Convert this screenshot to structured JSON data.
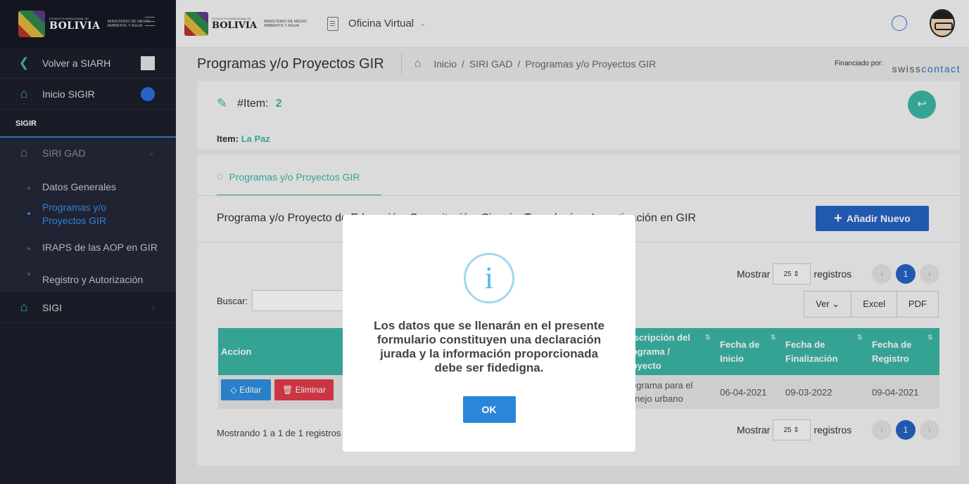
{
  "sidebar": {
    "logo": {
      "small": "ESTADO PLURINACIONAL DE",
      "name": "BOLIVIA",
      "ministry": "MINISTERIO DE MEDIO AMBIENTE Y AGUA"
    },
    "back_label": "Volver a SIARH",
    "home_label": "Inicio SIGIR",
    "section": "SIGIR",
    "group_label": "SIRI GAD",
    "subitems": [
      "Datos Generales",
      "Programas y/o Proyectos GIR",
      "IRAPS de las AOP en GIR",
      "Registro y Autorización"
    ],
    "sigi_label": "SIGI"
  },
  "topbar": {
    "logo": {
      "small": "ESTADO PLURINACIONAL DE",
      "name": "BOLIVIA",
      "ministry": "MINISTERIO DE MEDIO AMBIENTE Y AGUA"
    },
    "office_label": "Oficina Virtual"
  },
  "page": {
    "title": "Programas y/o Proyectos GIR",
    "breadcrumb": [
      "Inicio",
      "SIRI GAD",
      "Programas y/o Proyectos GIR"
    ],
    "funded_label": "Financiado por:",
    "sponsor": {
      "part1": "swiss",
      "part2": "contact"
    }
  },
  "card": {
    "item_label": "#Item:",
    "item_number": "2",
    "dept_label": "Item:",
    "dept_value": "La Paz",
    "tab_label": "Programas y/o Proyectos GIR",
    "section_title": "Programa y/o Proyecto de Educación, Capacitación, Ciencia, Tecnología e Investigación en GIR",
    "add_button": "Añadir Nuevo",
    "show_label": "Mostrar",
    "show_value": "25",
    "records_label": "registros",
    "page_current": "1",
    "search_label": "Buscar:",
    "export_buttons": [
      "Ver",
      "Excel",
      "PDF"
    ],
    "table": {
      "headers": [
        "Accion",
        "Descripción del Programa / Proyecto",
        "Fecha de Inicio",
        "Fecha de Finalización",
        "Fecha de Registro"
      ],
      "row": {
        "edit_label": "Editar",
        "delete_label": "Eliminar",
        "description": "Programa para el manejo urbano",
        "start": "06-04-2021",
        "end": "09-03-2022",
        "registered": "09-04-2021"
      }
    },
    "info_text": "Mostrando 1 a 1 de 1 registros"
  },
  "modal": {
    "icon": "info-icon",
    "message": "Los datos que se llenarán en el presente formulario constituyen una declaración jurada y la información proporcionada debe ser fidedigna.",
    "ok_label": "OK"
  },
  "colors": {
    "accent": "#3bb6a5",
    "primary": "#2563c4",
    "danger": "#e23b4a",
    "sidebar": "#1c1f2b"
  }
}
